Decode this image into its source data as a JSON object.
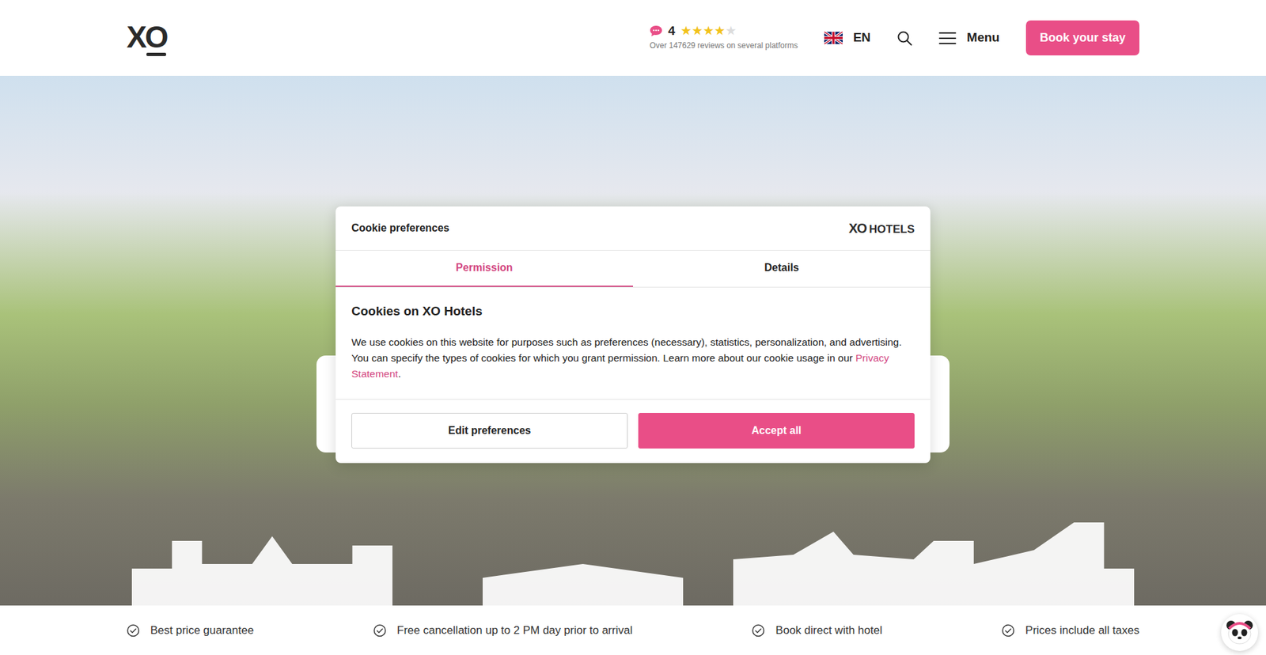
{
  "header": {
    "logo": "XO",
    "rating": {
      "score": "4",
      "stars": 4,
      "reviews": "Over 147629 reviews on several platforms"
    },
    "language": "EN",
    "menu": "Menu",
    "book_button": "Book your stay"
  },
  "cookie_dialog": {
    "title": "Cookie preferences",
    "brand": {
      "mark": "XO",
      "word": "HOTELS"
    },
    "tabs": [
      {
        "label": "Permission",
        "selected": true
      },
      {
        "label": "Details",
        "selected": false
      }
    ],
    "heading": "Cookies on XO Hotels",
    "body": "We use cookies on this website for purposes such as preferences (necessary), statistics, personalization, and advertising. You can specify the types of cookies for which you grant permission. Learn more about our cookie usage in our ",
    "link": "Privacy Statement",
    "body_end": ".",
    "buttons": [
      "Edit preferences",
      "Accept all"
    ]
  },
  "usps": [
    "Best price guarantee",
    "Free cancellation up to 2 PM day prior to arrival",
    "Book direct with hotel",
    "Prices include all taxes"
  ]
}
